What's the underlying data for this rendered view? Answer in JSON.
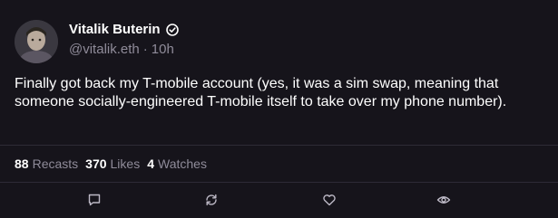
{
  "post": {
    "author": {
      "display_name": "Vitalik Buterin",
      "handle": "@vitalik.eth",
      "verified_icon": "verified-badge-icon"
    },
    "separator": "·",
    "timestamp": "10h",
    "text": "Finally got back my T-mobile account (yes, it was a sim swap, meaning that someone socially-engineered T-mobile itself to take over my phone number).",
    "stats": {
      "recasts_count": "88",
      "recasts_label": "Recasts",
      "likes_count": "370",
      "likes_label": "Likes",
      "watches_count": "4",
      "watches_label": "Watches"
    },
    "actions": [
      {
        "icon": "reply-icon"
      },
      {
        "icon": "recast-icon"
      },
      {
        "icon": "like-icon"
      },
      {
        "icon": "watch-icon"
      }
    ]
  },
  "colors": {
    "background": "#16141b",
    "text_primary": "#ffffff",
    "text_secondary": "#8f8b99",
    "divider": "#2e2b36"
  }
}
